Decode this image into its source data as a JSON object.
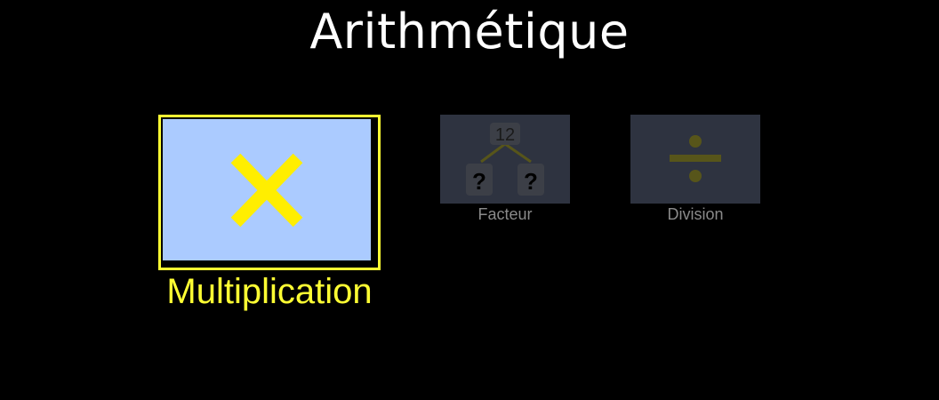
{
  "page": {
    "title": "Arithmétique"
  },
  "tiles": [
    {
      "label": "Multiplication",
      "icon": "multiply-icon",
      "selected": true
    },
    {
      "label": "Facteur",
      "icon": "factor-tree-icon",
      "selected": false,
      "root_value": "12",
      "unknown_left": "?",
      "unknown_right": "?"
    },
    {
      "label": "Division",
      "icon": "divide-icon",
      "selected": false
    }
  ],
  "colors": {
    "background": "#000000",
    "title": "#ffffff",
    "selected_border": "#ffff33",
    "selected_fill": "#abcbff",
    "selected_label": "#ffff33",
    "icon_accent": "#ffee00",
    "dim_tile": "#2e3340",
    "dim_label": "#8a8a8a",
    "dim_icon": "#57551a"
  }
}
